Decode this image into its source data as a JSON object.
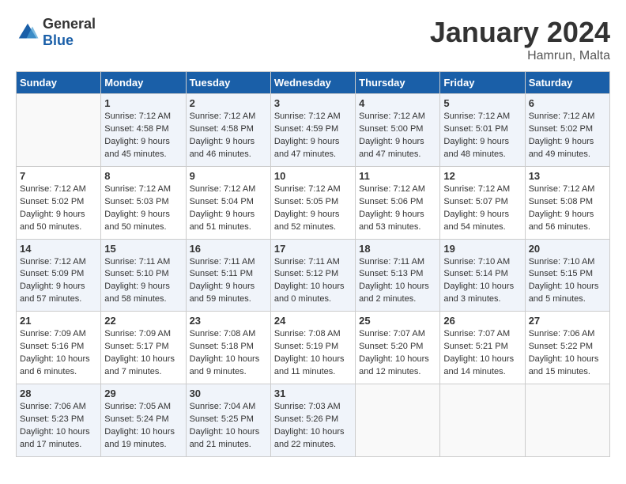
{
  "header": {
    "logo_general": "General",
    "logo_blue": "Blue",
    "month_title": "January 2024",
    "location": "Hamrun, Malta"
  },
  "weekdays": [
    "Sunday",
    "Monday",
    "Tuesday",
    "Wednesday",
    "Thursday",
    "Friday",
    "Saturday"
  ],
  "weeks": [
    [
      {
        "day": "",
        "sunrise": "",
        "sunset": "",
        "daylight": ""
      },
      {
        "day": "1",
        "sunrise": "Sunrise: 7:12 AM",
        "sunset": "Sunset: 4:58 PM",
        "daylight": "Daylight: 9 hours and 45 minutes."
      },
      {
        "day": "2",
        "sunrise": "Sunrise: 7:12 AM",
        "sunset": "Sunset: 4:58 PM",
        "daylight": "Daylight: 9 hours and 46 minutes."
      },
      {
        "day": "3",
        "sunrise": "Sunrise: 7:12 AM",
        "sunset": "Sunset: 4:59 PM",
        "daylight": "Daylight: 9 hours and 47 minutes."
      },
      {
        "day": "4",
        "sunrise": "Sunrise: 7:12 AM",
        "sunset": "Sunset: 5:00 PM",
        "daylight": "Daylight: 9 hours and 47 minutes."
      },
      {
        "day": "5",
        "sunrise": "Sunrise: 7:12 AM",
        "sunset": "Sunset: 5:01 PM",
        "daylight": "Daylight: 9 hours and 48 minutes."
      },
      {
        "day": "6",
        "sunrise": "Sunrise: 7:12 AM",
        "sunset": "Sunset: 5:02 PM",
        "daylight": "Daylight: 9 hours and 49 minutes."
      }
    ],
    [
      {
        "day": "7",
        "sunrise": "Sunrise: 7:12 AM",
        "sunset": "Sunset: 5:02 PM",
        "daylight": "Daylight: 9 hours and 50 minutes."
      },
      {
        "day": "8",
        "sunrise": "Sunrise: 7:12 AM",
        "sunset": "Sunset: 5:03 PM",
        "daylight": "Daylight: 9 hours and 50 minutes."
      },
      {
        "day": "9",
        "sunrise": "Sunrise: 7:12 AM",
        "sunset": "Sunset: 5:04 PM",
        "daylight": "Daylight: 9 hours and 51 minutes."
      },
      {
        "day": "10",
        "sunrise": "Sunrise: 7:12 AM",
        "sunset": "Sunset: 5:05 PM",
        "daylight": "Daylight: 9 hours and 52 minutes."
      },
      {
        "day": "11",
        "sunrise": "Sunrise: 7:12 AM",
        "sunset": "Sunset: 5:06 PM",
        "daylight": "Daylight: 9 hours and 53 minutes."
      },
      {
        "day": "12",
        "sunrise": "Sunrise: 7:12 AM",
        "sunset": "Sunset: 5:07 PM",
        "daylight": "Daylight: 9 hours and 54 minutes."
      },
      {
        "day": "13",
        "sunrise": "Sunrise: 7:12 AM",
        "sunset": "Sunset: 5:08 PM",
        "daylight": "Daylight: 9 hours and 56 minutes."
      }
    ],
    [
      {
        "day": "14",
        "sunrise": "Sunrise: 7:12 AM",
        "sunset": "Sunset: 5:09 PM",
        "daylight": "Daylight: 9 hours and 57 minutes."
      },
      {
        "day": "15",
        "sunrise": "Sunrise: 7:11 AM",
        "sunset": "Sunset: 5:10 PM",
        "daylight": "Daylight: 9 hours and 58 minutes."
      },
      {
        "day": "16",
        "sunrise": "Sunrise: 7:11 AM",
        "sunset": "Sunset: 5:11 PM",
        "daylight": "Daylight: 9 hours and 59 minutes."
      },
      {
        "day": "17",
        "sunrise": "Sunrise: 7:11 AM",
        "sunset": "Sunset: 5:12 PM",
        "daylight": "Daylight: 10 hours and 0 minutes."
      },
      {
        "day": "18",
        "sunrise": "Sunrise: 7:11 AM",
        "sunset": "Sunset: 5:13 PM",
        "daylight": "Daylight: 10 hours and 2 minutes."
      },
      {
        "day": "19",
        "sunrise": "Sunrise: 7:10 AM",
        "sunset": "Sunset: 5:14 PM",
        "daylight": "Daylight: 10 hours and 3 minutes."
      },
      {
        "day": "20",
        "sunrise": "Sunrise: 7:10 AM",
        "sunset": "Sunset: 5:15 PM",
        "daylight": "Daylight: 10 hours and 5 minutes."
      }
    ],
    [
      {
        "day": "21",
        "sunrise": "Sunrise: 7:09 AM",
        "sunset": "Sunset: 5:16 PM",
        "daylight": "Daylight: 10 hours and 6 minutes."
      },
      {
        "day": "22",
        "sunrise": "Sunrise: 7:09 AM",
        "sunset": "Sunset: 5:17 PM",
        "daylight": "Daylight: 10 hours and 7 minutes."
      },
      {
        "day": "23",
        "sunrise": "Sunrise: 7:08 AM",
        "sunset": "Sunset: 5:18 PM",
        "daylight": "Daylight: 10 hours and 9 minutes."
      },
      {
        "day": "24",
        "sunrise": "Sunrise: 7:08 AM",
        "sunset": "Sunset: 5:19 PM",
        "daylight": "Daylight: 10 hours and 11 minutes."
      },
      {
        "day": "25",
        "sunrise": "Sunrise: 7:07 AM",
        "sunset": "Sunset: 5:20 PM",
        "daylight": "Daylight: 10 hours and 12 minutes."
      },
      {
        "day": "26",
        "sunrise": "Sunrise: 7:07 AM",
        "sunset": "Sunset: 5:21 PM",
        "daylight": "Daylight: 10 hours and 14 minutes."
      },
      {
        "day": "27",
        "sunrise": "Sunrise: 7:06 AM",
        "sunset": "Sunset: 5:22 PM",
        "daylight": "Daylight: 10 hours and 15 minutes."
      }
    ],
    [
      {
        "day": "28",
        "sunrise": "Sunrise: 7:06 AM",
        "sunset": "Sunset: 5:23 PM",
        "daylight": "Daylight: 10 hours and 17 minutes."
      },
      {
        "day": "29",
        "sunrise": "Sunrise: 7:05 AM",
        "sunset": "Sunset: 5:24 PM",
        "daylight": "Daylight: 10 hours and 19 minutes."
      },
      {
        "day": "30",
        "sunrise": "Sunrise: 7:04 AM",
        "sunset": "Sunset: 5:25 PM",
        "daylight": "Daylight: 10 hours and 21 minutes."
      },
      {
        "day": "31",
        "sunrise": "Sunrise: 7:03 AM",
        "sunset": "Sunset: 5:26 PM",
        "daylight": "Daylight: 10 hours and 22 minutes."
      },
      {
        "day": "",
        "sunrise": "",
        "sunset": "",
        "daylight": ""
      },
      {
        "day": "",
        "sunrise": "",
        "sunset": "",
        "daylight": ""
      },
      {
        "day": "",
        "sunrise": "",
        "sunset": "",
        "daylight": ""
      }
    ]
  ]
}
